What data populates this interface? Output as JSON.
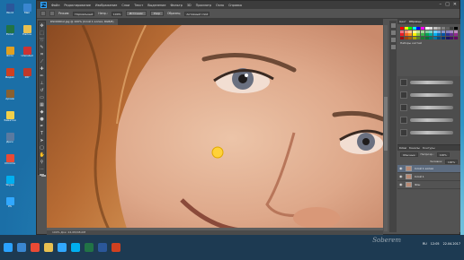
{
  "desktop": {
    "icons": [
      {
        "label": "Word",
        "color": "#2b579a"
      },
      {
        "label": "Excel",
        "color": "#217346"
      },
      {
        "label": "Фото",
        "color": "#e0a020"
      },
      {
        "label": "Видео",
        "color": "#d04020"
      },
      {
        "label": "Архив",
        "color": "#8a6030"
      },
      {
        "label": "Заметки",
        "color": "#f2d04a"
      },
      {
        "label": "Диск",
        "color": "#5a7aa0"
      },
      {
        "label": "Chrome",
        "color": "#e94a35"
      },
      {
        "label": "Skype",
        "color": "#00aff0"
      },
      {
        "label": "PS",
        "color": "#31a8ff"
      },
      {
        "label": "Mail",
        "color": "#3a86d0"
      },
      {
        "label": "Папка",
        "color": "#e8c050"
      },
      {
        "label": "Uninstall",
        "color": "#cc3333"
      },
      {
        "label": "Pdf",
        "color": "#c0392b"
      }
    ]
  },
  "menubar": {
    "logo": "Ps",
    "items": [
      "Файл",
      "Редактирование",
      "Изображение",
      "Слои",
      "Текст",
      "Выделение",
      "Фильтр",
      "3D",
      "Просмотр",
      "Окно",
      "Справка"
    ],
    "minimize": "–",
    "maximize": "□",
    "close": "✕"
  },
  "options": {
    "mode_label": "Режим:",
    "mode_value": "Нормальный",
    "opacity_label": "Непр.:",
    "opacity_value": "100%",
    "source_button": "Источник",
    "pattern_button": "Узор",
    "sample_label": "Образец:",
    "sample_value": "Активный слой"
  },
  "document": {
    "tab_title": "DSC06612.jpg @ 100% (Слой 1 копия, RGB/8)",
    "status": "100%     Док: 24,0M/48,0M"
  },
  "panels": {
    "swatches_tab": "Образцы",
    "color_tab": "Цвет",
    "brushes_label": "Наборы кистей",
    "layers_tabs": [
      "Слои",
      "Каналы",
      "Контуры"
    ],
    "blend_mode": "Обычные",
    "opacity_label": "Непрозр.:",
    "opacity_value": "100%",
    "fill_label": "Заливка:",
    "fill_value": "100%",
    "layers": [
      {
        "name": "Слой 1 копия",
        "selected": true
      },
      {
        "name": "Слой 1",
        "selected": false
      },
      {
        "name": "Фон",
        "selected": false
      }
    ],
    "swatch_colors": [
      "#ff0000",
      "#ffff00",
      "#00ff00",
      "#00ffff",
      "#0000ff",
      "#ff00ff",
      "#ffffff",
      "#e0e0e0",
      "#c0c0c0",
      "#a0a0a0",
      "#808080",
      "#606060",
      "#404040",
      "#000000",
      "#f26d7d",
      "#f7977a",
      "#fdc68a",
      "#fff79a",
      "#c4df9b",
      "#a3d39c",
      "#82ca9d",
      "#7bcdc8",
      "#6ecff6",
      "#7ea7d8",
      "#8493ca",
      "#8882be",
      "#a187be",
      "#bc8dbf",
      "#ed1c24",
      "#f26522",
      "#f7941d",
      "#fff200",
      "#8dc73f",
      "#39b54a",
      "#00a651",
      "#00a99d",
      "#00aeef",
      "#0072bc",
      "#0054a6",
      "#2e3192",
      "#662d91",
      "#92278f",
      "#9e0b0f",
      "#a0410d",
      "#a36209",
      "#aba000",
      "#598527",
      "#1a7b30",
      "#007236",
      "#00746b",
      "#0076a3",
      "#004b80",
      "#003471",
      "#1b1464",
      "#440e62",
      "#630460"
    ]
  },
  "taskbar": {
    "apps": [
      "#3a86d0",
      "#e94a35",
      "#e8c050",
      "#31a8ff",
      "#00aff0",
      "#217346",
      "#2b579a",
      "#d04020"
    ],
    "lang": "RU",
    "time": "12:05",
    "date": "22.04.2017"
  },
  "watermark": "Soberem"
}
